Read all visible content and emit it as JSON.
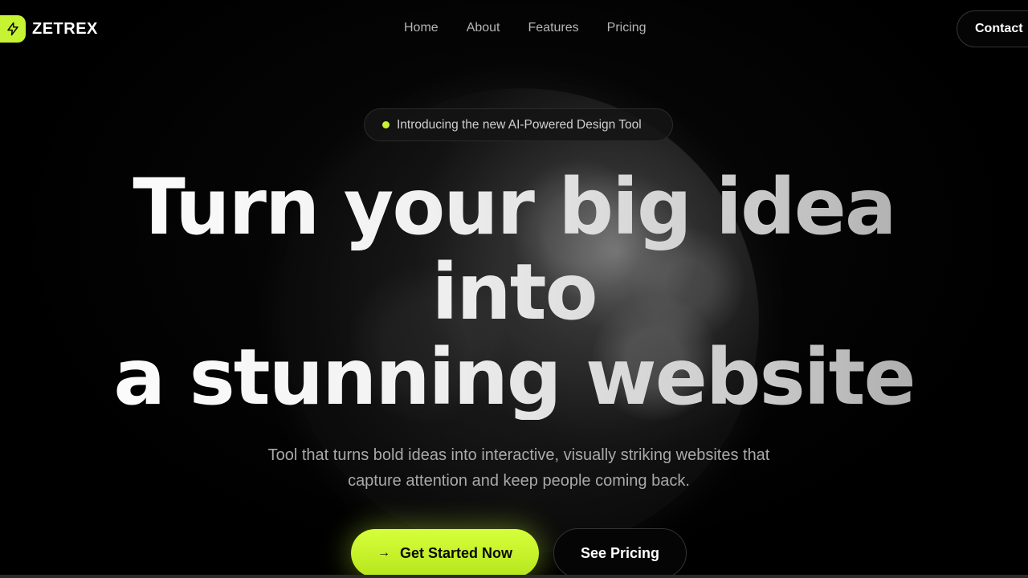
{
  "brand": {
    "name": "ZETREX",
    "logo_icon": "lightning-icon",
    "accent": "#c6f432"
  },
  "nav": {
    "links": [
      {
        "label": "Home"
      },
      {
        "label": "About"
      },
      {
        "label": "Features"
      },
      {
        "label": "Pricing"
      }
    ],
    "contact_label": "Contact"
  },
  "hero": {
    "badge_text": "Introducing the new AI-Powered Design Tool",
    "headline": [
      "Turn your big idea",
      "into",
      "a stunning website"
    ],
    "subtitle_line1": "Tool that turns bold ideas into interactive, visually striking websites that",
    "subtitle_line2": "capture attention and keep people coming back.",
    "primary_cta": "Get Started Now",
    "primary_cta_icon": "arrow-right-icon",
    "secondary_cta": "See Pricing"
  }
}
